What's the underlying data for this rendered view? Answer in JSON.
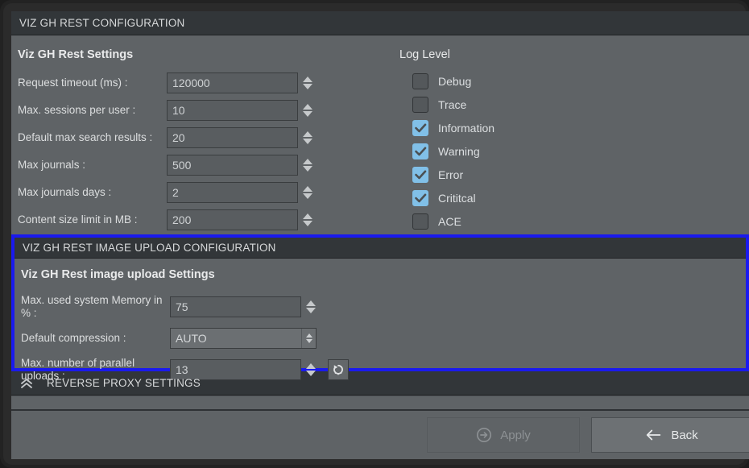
{
  "window": {
    "title": "VIZ GH REST CONFIGURATION"
  },
  "rest_settings": {
    "group_title": "Viz GH Rest Settings",
    "fields": [
      {
        "label": "Request timeout (ms) :",
        "value": "120000",
        "name": "request-timeout"
      },
      {
        "label": "Max. sessions per user :",
        "value": "10",
        "name": "max-sessions-per-user"
      },
      {
        "label": "Default max search results :",
        "value": "20",
        "name": "default-max-search-results"
      },
      {
        "label": "Max journals :",
        "value": "500",
        "name": "max-journals"
      },
      {
        "label": "Max journals days :",
        "value": "2",
        "name": "max-journals-days"
      },
      {
        "label": "Content size limit in MB :",
        "value": "200",
        "name": "content-size-limit"
      }
    ]
  },
  "log_level": {
    "title": "Log Level",
    "items": [
      {
        "label": "Debug",
        "checked": false
      },
      {
        "label": "Trace",
        "checked": false
      },
      {
        "label": "Information",
        "checked": true
      },
      {
        "label": "Warning",
        "checked": true
      },
      {
        "label": "Error",
        "checked": true
      },
      {
        "label": "Crititcal",
        "checked": true
      },
      {
        "label": "ACE",
        "checked": false
      }
    ]
  },
  "image_upload": {
    "header": "VIZ GH REST IMAGE UPLOAD CONFIGURATION",
    "group_title": "Viz GH Rest image upload Settings",
    "memory_label": "Max. used system Memory in % :",
    "memory_value": "75",
    "compression_label": "Default compression :",
    "compression_value": "AUTO",
    "parallel_label": "Max. number of parallel uploads :",
    "parallel_value": "13",
    "reset_icon": "reset-icon"
  },
  "reverse_proxy": {
    "header": "REVERSE PROXY SETTINGS",
    "collapse_icon": "chevron-up-double-icon"
  },
  "actions": {
    "apply_label": "Apply",
    "apply_icon": "arrow-right-circle-icon",
    "apply_enabled": false,
    "back_label": "Back",
    "back_icon": "arrow-left-icon"
  },
  "colors": {
    "panel_bg": "#5f6366",
    "header_bg": "#323639",
    "highlight_border": "#1a1aee",
    "checkbox_on": "#81c0e8",
    "text": "#dcdfe1"
  }
}
